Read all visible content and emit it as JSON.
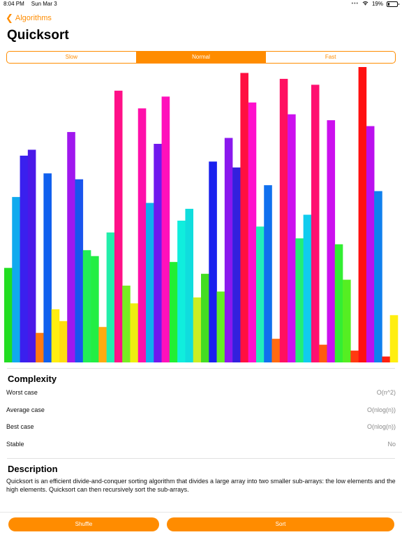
{
  "status": {
    "time": "8:04 PM",
    "date": "Sun Mar 3",
    "battery": "19%"
  },
  "nav": {
    "back_label": "Algorithms"
  },
  "page_title": "Quicksort",
  "speed": {
    "options": [
      "Slow",
      "Normal",
      "Fast"
    ],
    "selected": "Normal"
  },
  "chart_data": {
    "type": "bar",
    "y_max": 100,
    "bars": [
      {
        "value": 32,
        "color": "#22dd22"
      },
      {
        "value": 56,
        "color": "#10aaee"
      },
      {
        "value": 70,
        "color": "#3a20ee"
      },
      {
        "value": 72,
        "color": "#4a18e8"
      },
      {
        "value": 10,
        "color": "#ff7a10"
      },
      {
        "value": 64,
        "color": "#1060ee"
      },
      {
        "value": 18,
        "color": "#ffee10"
      },
      {
        "value": 14,
        "color": "#ffdd10"
      },
      {
        "value": 78,
        "color": "#a018ee"
      },
      {
        "value": 62,
        "color": "#1a55ee"
      },
      {
        "value": 38,
        "color": "#22ee55"
      },
      {
        "value": 36,
        "color": "#22ee44"
      },
      {
        "value": 12,
        "color": "#ffaa10"
      },
      {
        "value": 44,
        "color": "#22eeaa"
      },
      {
        "value": 92,
        "color": "#ff1088"
      },
      {
        "value": 26,
        "color": "#77ee22"
      },
      {
        "value": 20,
        "color": "#eeee10"
      },
      {
        "value": 86,
        "color": "#ff10aa"
      },
      {
        "value": 54,
        "color": "#10b0ee"
      },
      {
        "value": 74,
        "color": "#7018ee"
      },
      {
        "value": 90,
        "color": "#ff10bb"
      },
      {
        "value": 34,
        "color": "#22ee33"
      },
      {
        "value": 48,
        "color": "#10eedd"
      },
      {
        "value": 52,
        "color": "#10dddd"
      },
      {
        "value": 22,
        "color": "#ccee22"
      },
      {
        "value": 30,
        "color": "#44dd22"
      },
      {
        "value": 68,
        "color": "#1a20ee"
      },
      {
        "value": 24,
        "color": "#66ee22"
      },
      {
        "value": 76,
        "color": "#8a18ee"
      },
      {
        "value": 66,
        "color": "#3320dd"
      },
      {
        "value": 98,
        "color": "#ff1040"
      },
      {
        "value": 88,
        "color": "#ff10cc"
      },
      {
        "value": 46,
        "color": "#22eebb"
      },
      {
        "value": 60,
        "color": "#1070ee"
      },
      {
        "value": 8,
        "color": "#ff6a10"
      },
      {
        "value": 96,
        "color": "#ff1060"
      },
      {
        "value": 84,
        "color": "#cc10ee"
      },
      {
        "value": 42,
        "color": "#22ee77"
      },
      {
        "value": 50,
        "color": "#10ccee"
      },
      {
        "value": 94,
        "color": "#ff1070"
      },
      {
        "value": 6,
        "color": "#ff5a10"
      },
      {
        "value": 82,
        "color": "#cc10ee"
      },
      {
        "value": 40,
        "color": "#33ee33"
      },
      {
        "value": 28,
        "color": "#55ee22"
      },
      {
        "value": 4,
        "color": "#ff3a10"
      },
      {
        "value": 100,
        "color": "#ff1010"
      },
      {
        "value": 80,
        "color": "#bb10ee"
      },
      {
        "value": 58,
        "color": "#1080ee"
      },
      {
        "value": 2,
        "color": "#ff2010"
      },
      {
        "value": 16,
        "color": "#ffee10"
      }
    ]
  },
  "complexity": {
    "title": "Complexity",
    "rows": [
      {
        "label": "Worst case",
        "value": "O(n^2)"
      },
      {
        "label": "Average case",
        "value": "O(nlog(n))"
      },
      {
        "label": "Best case",
        "value": "O(nlog(n))"
      },
      {
        "label": "Stable",
        "value": "No"
      }
    ]
  },
  "description": {
    "title": "Description",
    "text": "Quicksort is an efficient divide-and-conquer sorting algorithm that divides a large array into two smaller sub-arrays: the low elements and the high elements. Quicksort can then recursively sort the sub-arrays."
  },
  "actions": {
    "shuffle_label": "Shuffle",
    "sort_label": "Sort"
  },
  "colors": {
    "accent": "#ff8c00"
  }
}
